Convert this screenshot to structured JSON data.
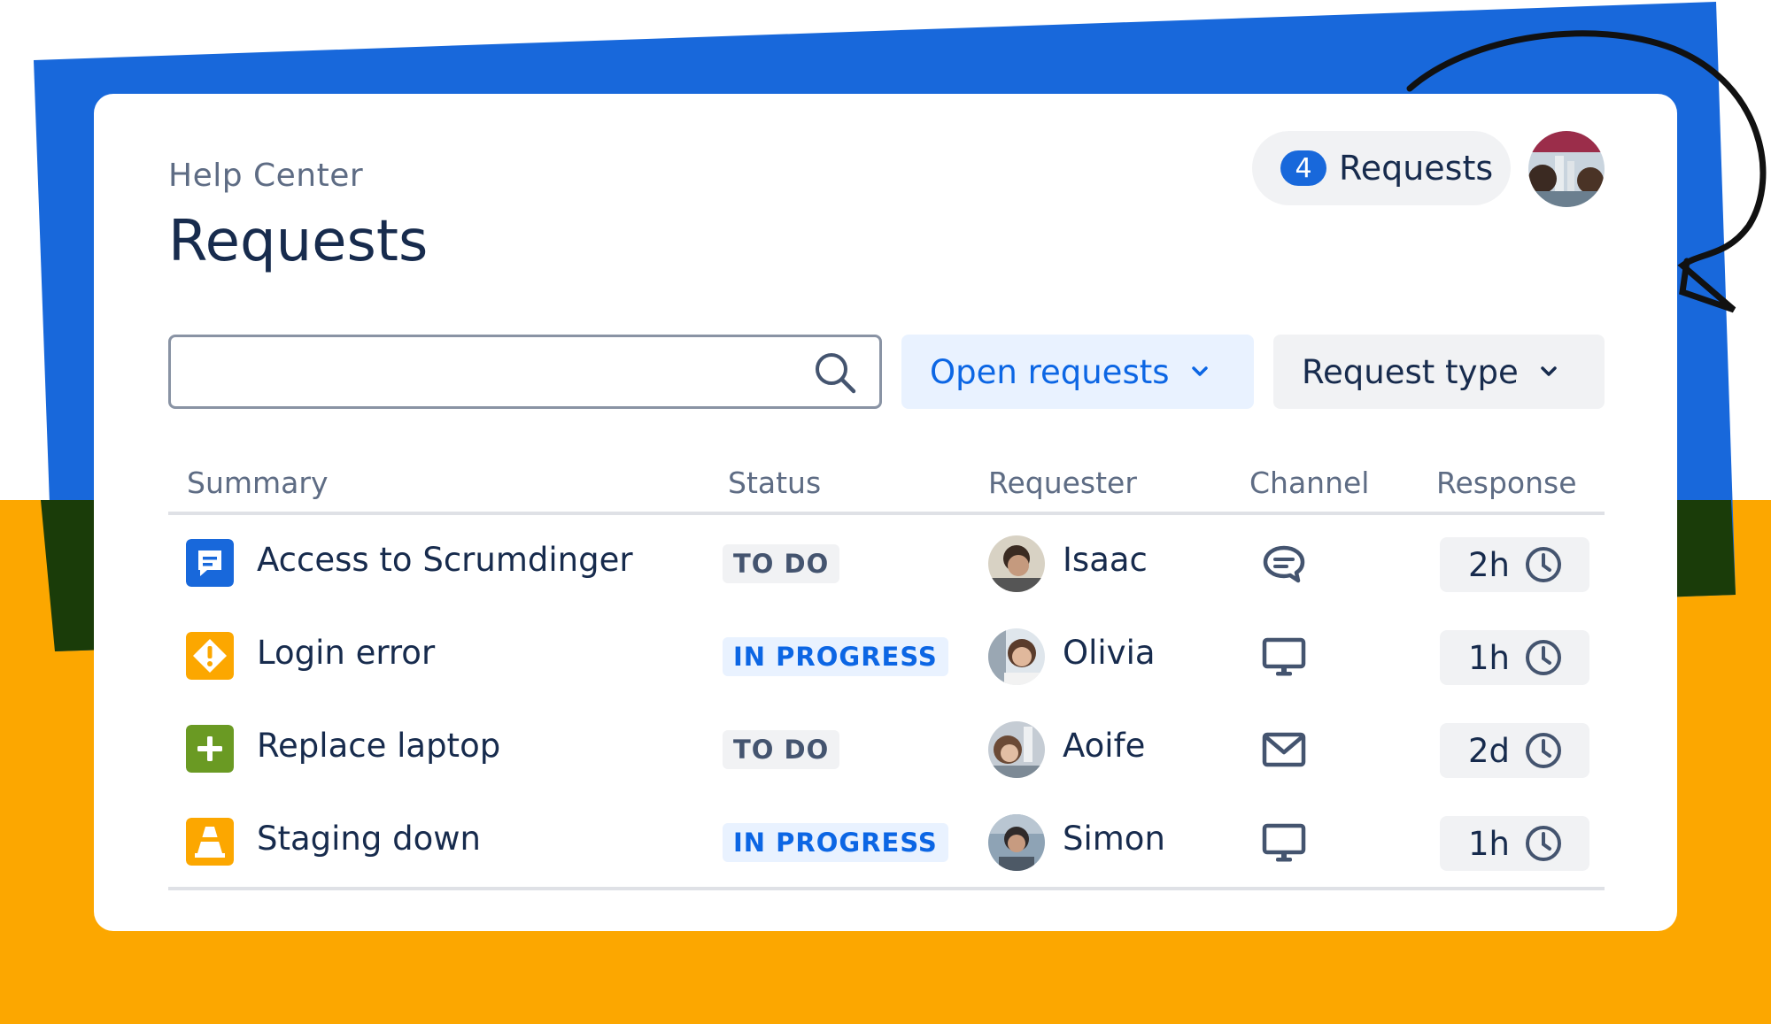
{
  "colors": {
    "brand_blue": "#1868db",
    "accent_yellow": "#fca700",
    "dark_green": "#1a3c09",
    "in_progress_text": "#0c66e4",
    "todo_text": "#44546f"
  },
  "page": {
    "breadcrumb": "Help Center",
    "title": "Requests"
  },
  "header": {
    "request_count": "4",
    "request_label": "Requests",
    "avatar_icon": "user-avatar"
  },
  "search": {
    "value": "",
    "placeholder": "",
    "icon": "search-icon"
  },
  "filters": {
    "open_requests": "Open requests",
    "request_type": "Request type"
  },
  "table": {
    "columns": [
      "Summary",
      "Status",
      "Requester",
      "Channel",
      "Response"
    ],
    "rows": [
      {
        "type_icon": "chat-request-icon",
        "type_color": "#1868db",
        "summary": "Access to Scrumdinger",
        "status": "TO DO",
        "requester": "Isaac",
        "channel_icon": "chat-icon",
        "response": "2h"
      },
      {
        "type_icon": "alert-diamond-icon",
        "type_color": "#fca700",
        "summary": "Login error",
        "status": "IN PROGRESS",
        "requester": "Olivia",
        "channel_icon": "monitor-icon",
        "response": "1h"
      },
      {
        "type_icon": "plus-icon",
        "type_color": "#6a9a23",
        "summary": "Replace laptop",
        "status": "TO DO",
        "requester": "Aoife",
        "channel_icon": "email-icon",
        "response": "2d"
      },
      {
        "type_icon": "traffic-cone-icon",
        "type_color": "#fca700",
        "summary": "Staging down",
        "status": "IN PROGRESS",
        "requester": "Simon",
        "channel_icon": "monitor-icon",
        "response": "1h"
      }
    ]
  }
}
